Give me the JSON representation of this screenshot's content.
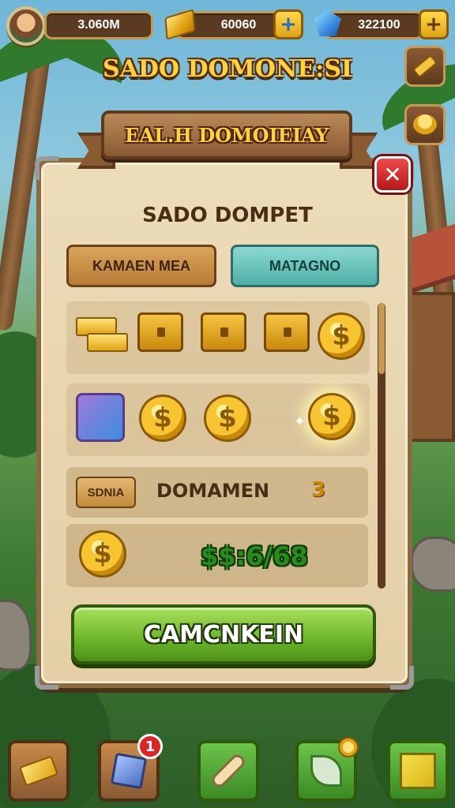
{
  "hud": {
    "coins_value": "3.060M",
    "gold_value": "60060",
    "gems_value": "322100",
    "plus_label": "+"
  },
  "screen_title": "SADO DOMONE:SI",
  "ribbon_title": "EAL.H DOMOIEIAY",
  "close_label": "✕",
  "panel": {
    "title": "SADO DOMPET",
    "tabs": [
      {
        "label": "KAMAEN MEA"
      },
      {
        "label": "MATAGNO"
      }
    ]
  },
  "items": {
    "coin_symbol": "$",
    "row1": [
      "gold-bars",
      "gold-chest-blue-gems",
      "gold-chest-green-gems",
      "gold-chest-blue-gems",
      "gold-coin"
    ],
    "row2": [
      "coin-gem-pack",
      "gold-coin",
      "gold-coin",
      "glowing-gold-coin"
    ]
  },
  "summary": {
    "badge": "SDNIA",
    "label": "DOMAMEN",
    "count": "3",
    "price": "$$:6/68"
  },
  "confirm_label": "CAMCNKEIN",
  "toolbar": {
    "notification_count": "1",
    "tools": [
      "gold-bar",
      "blue-cube",
      "scroll",
      "leaf-scroll",
      "yellow-box"
    ]
  },
  "colors": {
    "panel": "#e4cfa6",
    "confirm_green": "#6cb52a",
    "close_red": "#d02020",
    "gold": "#f7c531"
  }
}
